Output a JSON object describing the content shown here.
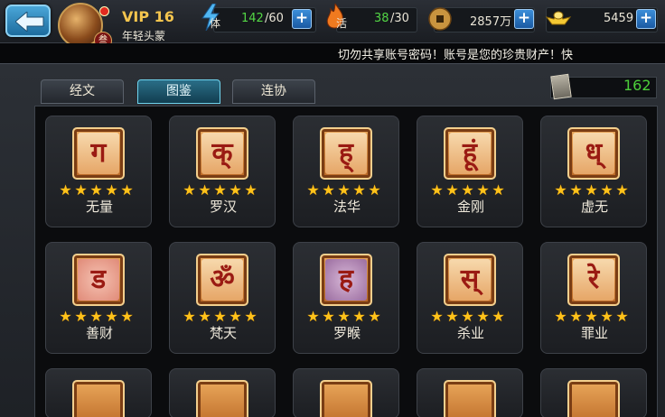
{
  "header": {
    "vip": "VIP 16",
    "player_title": "年轻头蒙",
    "rank_badge": "叁",
    "stamina_label": "体",
    "stamina_current": "142",
    "stamina_max": "/60",
    "energy_label": "活",
    "energy_current": "38",
    "energy_max": "/30",
    "coins": "2857万",
    "gold": "5459",
    "plus": "+"
  },
  "notice": "切勿共享账号密码！账号是您的珍贵财产！快",
  "tabs": [
    {
      "label": "经文"
    },
    {
      "label": "图鉴"
    },
    {
      "label": "连协"
    }
  ],
  "active_tab": "图鉴",
  "collection_count": "162",
  "cards": [
    {
      "name": "无量",
      "glyph": "ग",
      "stars": 5
    },
    {
      "name": "罗汉",
      "glyph": "क्",
      "stars": 5
    },
    {
      "name": "法华",
      "glyph": "ह्",
      "stars": 5
    },
    {
      "name": "金刚",
      "glyph": "हूं",
      "stars": 5
    },
    {
      "name": "虚无",
      "glyph": "ध्",
      "stars": 5
    },
    {
      "name": "善财",
      "glyph": "ड",
      "stars": 5
    },
    {
      "name": "梵天",
      "glyph": "ॐ",
      "stars": 5
    },
    {
      "name": "罗睺",
      "glyph": "ह",
      "stars": 5
    },
    {
      "name": "杀业",
      "glyph": "स्",
      "stars": 5
    },
    {
      "name": "罪业",
      "glyph": "रे",
      "stars": 5
    }
  ],
  "colors": {
    "accent_gold": "#f4c54e",
    "value_green": "#53d645",
    "star_gold": "#ffc21a",
    "active_tab": "#2a6e87"
  },
  "icons": {
    "stamina": "lightning-icon",
    "energy": "flame-icon",
    "coins": "copper-coin-icon",
    "gold": "gold-ingot-icon",
    "back": "back-arrow-icon",
    "collection": "scroll-icon"
  }
}
